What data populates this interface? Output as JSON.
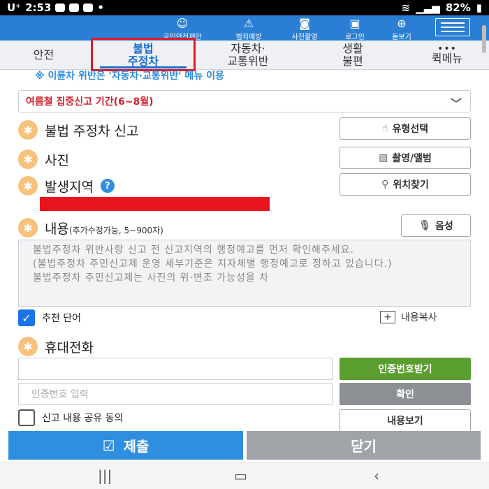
{
  "status_bar": {
    "carrier": "U⁺",
    "time": "2:53",
    "battery": "82%"
  },
  "header": {
    "items": [
      {
        "label": "국민안전제안",
        "icon": "person-icon"
      },
      {
        "label": "범죄예방",
        "icon": "siren-icon"
      },
      {
        "label": "사진촬영",
        "icon": "camera-icon"
      },
      {
        "label": "로그인",
        "icon": "lock-icon"
      },
      {
        "label": "돋보기",
        "icon": "zoom-icon"
      }
    ]
  },
  "tabs": [
    {
      "line1": "안전",
      "line2": ""
    },
    {
      "line1": "불법",
      "line2": "주정차"
    },
    {
      "line1": "자동차·",
      "line2": "교통위반"
    },
    {
      "line1": "생활",
      "line2": "불편"
    },
    {
      "line1": "•••",
      "line2": "퀵메뉴"
    }
  ],
  "notice": "※ 이륜차 위반은 '자동차·교통위반' 메뉴 이용",
  "period_select": "여름철 집중신고 기간(6~8월)",
  "fields": {
    "report_type": {
      "label": "불법 주정차 신고",
      "button": "유형선택"
    },
    "photo": {
      "label": "사진",
      "button": "촬영/앨범"
    },
    "location": {
      "label": "발생지역",
      "help": "?",
      "button": "위치찾기"
    },
    "content": {
      "label": "내용",
      "sub": "(추가수정가능, 5~900자)",
      "button": "음성"
    }
  },
  "content_text": "불법주정차 위반사항 신고 전 신고지역의 행정예고를 먼저 확인해주세요.\n(불법주정차 주민신고제 운영 세부기준은 지자체별 행정예고로 정하고 있습니다.)\n불법주정차 주민신고제는 사진의 위·변조 가능성을 차",
  "recommend": {
    "label": "추천 단어",
    "checked": true
  },
  "copy_label": "내용복사",
  "phone": {
    "label": "휴대전화",
    "phone_value": "",
    "request_button": "인증번호받기",
    "code_placeholder": "인증번호 입력",
    "confirm_button": "확인"
  },
  "share": {
    "label": "신고 내용 공유 동의",
    "checked": false,
    "view_button": "내용보기"
  },
  "actions": {
    "submit": "제출",
    "close": "닫기"
  },
  "colors": {
    "header_blue": "#2a7fd4",
    "active_tab": "#1a6ed0",
    "highlight_red": "#e01a2b",
    "submit_blue": "#2f8ee0",
    "green": "#5a9e2f"
  }
}
